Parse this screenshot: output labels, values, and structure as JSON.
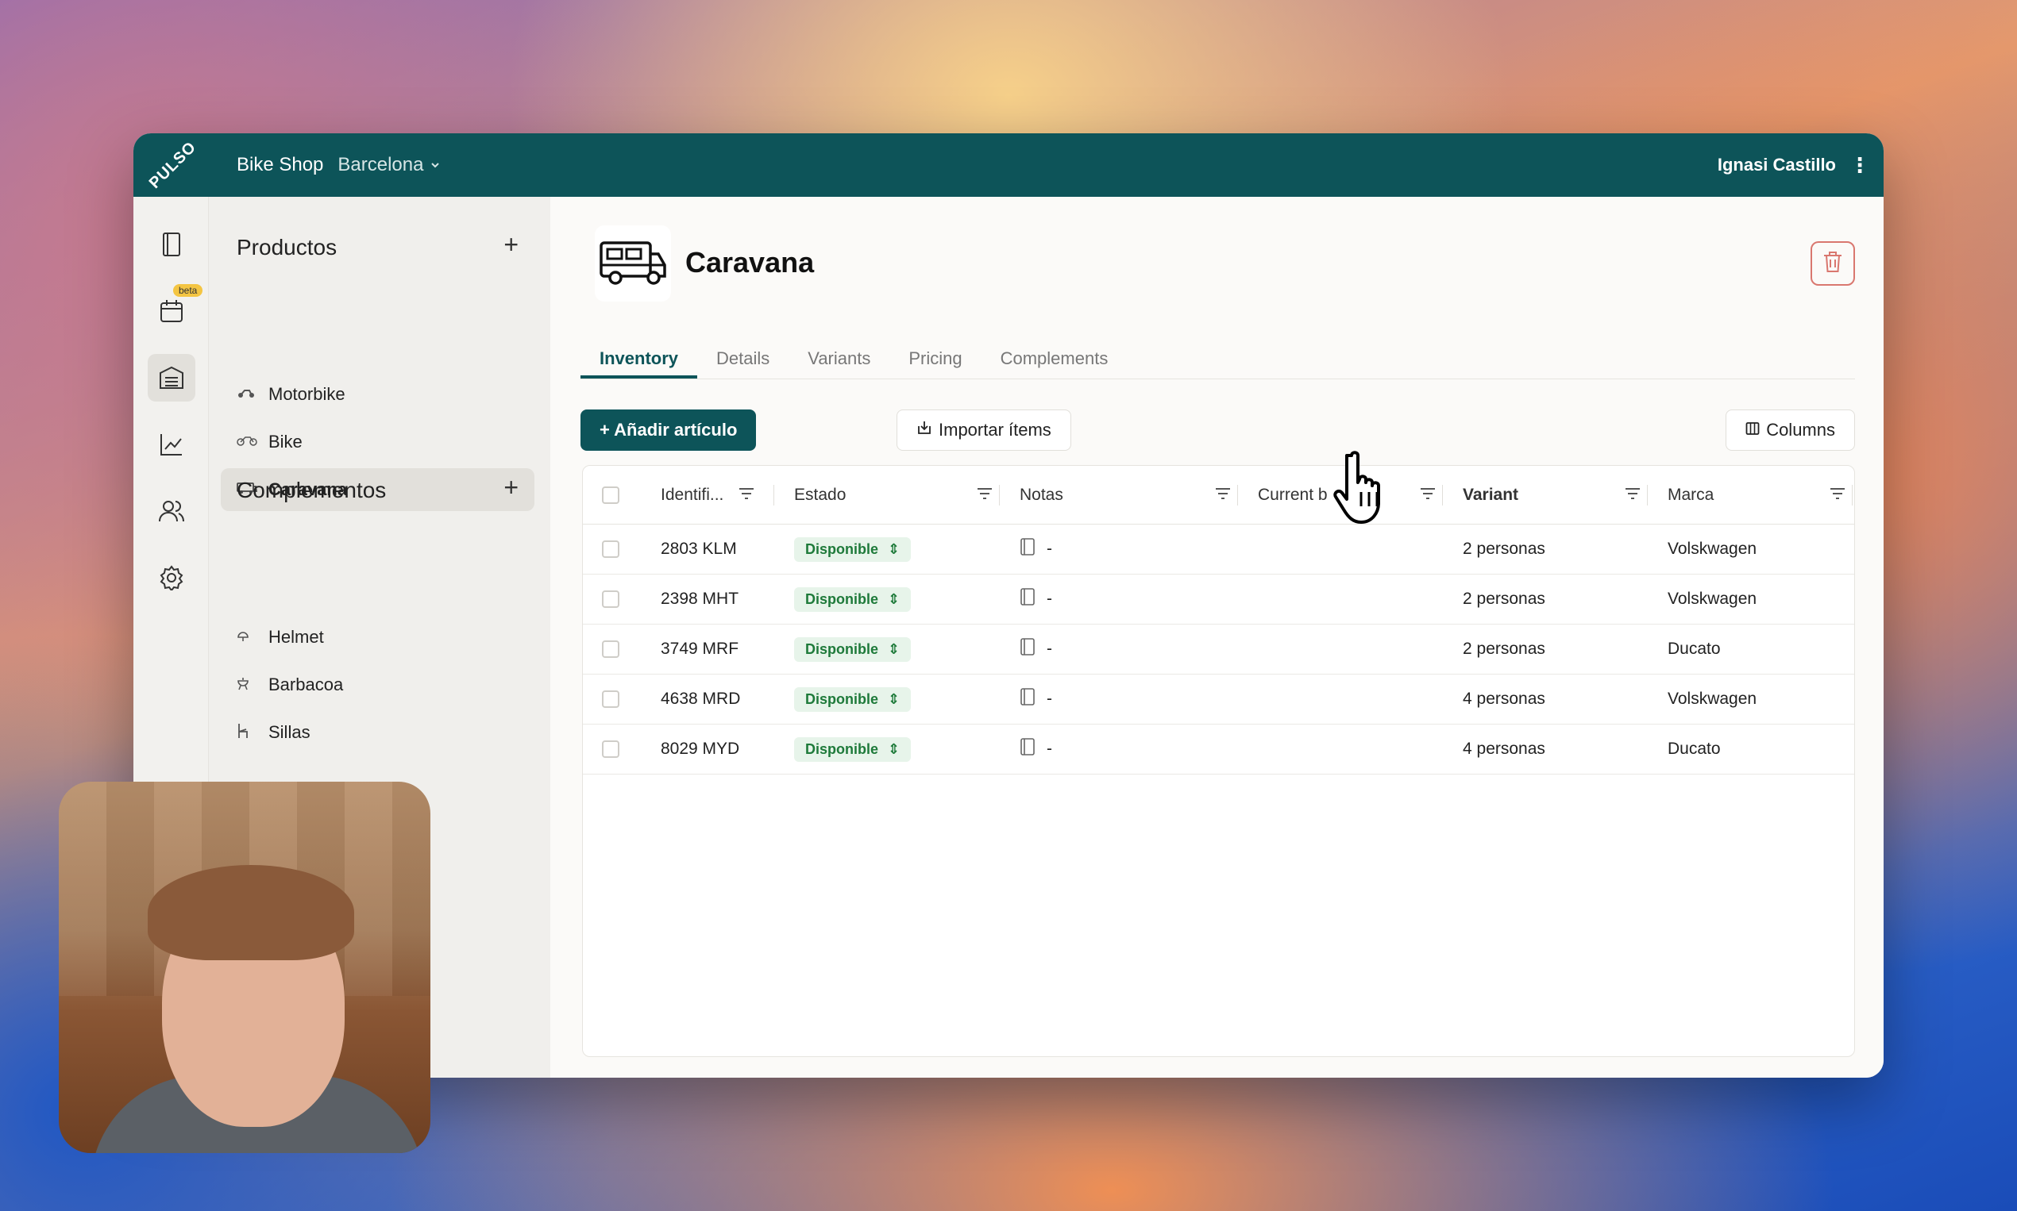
{
  "app": {
    "logo": "PULSO",
    "shop": "Bike Shop",
    "city": "Barcelona",
    "user": "Ignasi Castillo"
  },
  "rail": {
    "beta": "beta",
    "items": [
      "orders-icon",
      "calendar-icon",
      "inventory-icon",
      "chart-icon",
      "users-icon",
      "settings-icon"
    ]
  },
  "sidebar": {
    "productos_title": "Productos",
    "productos": [
      {
        "label": "Motorbike",
        "icon": "motorbike-icon"
      },
      {
        "label": "Bike",
        "icon": "bike-icon"
      },
      {
        "label": "Caravana",
        "icon": "caravan-icon"
      }
    ],
    "complementos_title": "Complementos",
    "complementos": [
      {
        "label": "Helmet",
        "icon": "helmet-icon"
      },
      {
        "label": "Barbacoa",
        "icon": "barbecue-icon"
      },
      {
        "label": "Sillas",
        "icon": "chair-icon"
      }
    ]
  },
  "page": {
    "title": "Caravana",
    "tabs": [
      "Inventory",
      "Details",
      "Variants",
      "Pricing",
      "Complements"
    ],
    "add_button": "+ Añadir artículo",
    "import_button": "Importar ítems",
    "columns_button": "Columns"
  },
  "table": {
    "headers": [
      "Identifi...",
      "Estado",
      "Notas",
      "Current b",
      "Variant",
      "Marca"
    ],
    "rows": [
      {
        "id": "2803 KLM",
        "estado": "Disponible",
        "notas": "-",
        "variant": "2 personas",
        "marca": "Volskwagen"
      },
      {
        "id": "2398 MHT",
        "estado": "Disponible",
        "notas": "-",
        "variant": "2 personas",
        "marca": "Volskwagen"
      },
      {
        "id": "3749 MRF",
        "estado": "Disponible",
        "notas": "-",
        "variant": "2 personas",
        "marca": "Ducato"
      },
      {
        "id": "4638 MRD",
        "estado": "Disponible",
        "notas": "-",
        "variant": "4 personas",
        "marca": "Volskwagen"
      },
      {
        "id": "8029 MYD",
        "estado": "Disponible",
        "notas": "-",
        "variant": "4 personas",
        "marca": "Ducato"
      }
    ]
  },
  "colors": {
    "brand": "#0d5459",
    "status_bg": "#e7f4ea",
    "status_text": "#1e7a3a",
    "danger": "#d9776f"
  }
}
